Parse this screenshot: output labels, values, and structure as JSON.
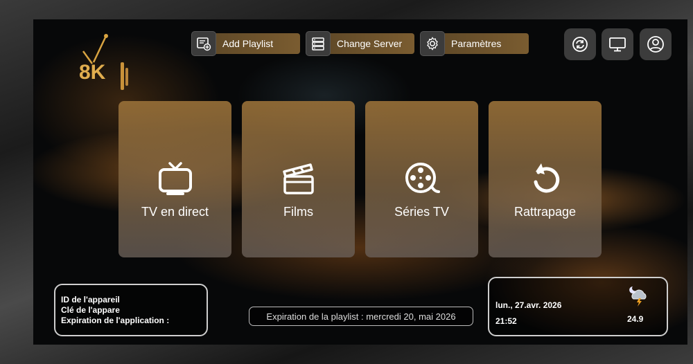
{
  "toolbar": {
    "add_playlist": "Add Playlist",
    "change_server": "Change Server",
    "settings": "Paramètres"
  },
  "logo": {
    "text": "8K"
  },
  "tiles": [
    {
      "label": "TV en direct",
      "icon": "tv-icon"
    },
    {
      "label": "Films",
      "icon": "clapperboard-icon"
    },
    {
      "label": "Séries TV",
      "icon": "film-reel-icon"
    },
    {
      "label": "Rattrapage",
      "icon": "replay-icon"
    }
  ],
  "device_info": {
    "device_id_label": "ID de l'appareil",
    "device_key_label": "Clé de l'appare",
    "app_expiration_label": "Expiration de l'application :"
  },
  "playlist_expiration": "Expiration de la playlist : mercredi 20, mai 2026",
  "datetime": {
    "date": "lun., 27.avr. 2026",
    "time": "21:52",
    "temperature": "24.9",
    "weather_icon": "night-storm-icon"
  },
  "colors": {
    "tile_top": "#96703a",
    "accent_gold": "#d9a441",
    "toolbar_button": "#6a5029"
  }
}
